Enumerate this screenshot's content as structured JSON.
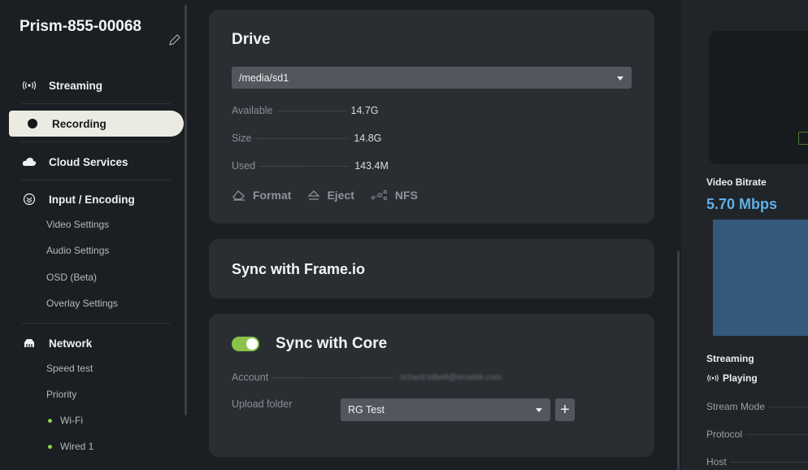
{
  "sidebar": {
    "device_name": "Prism-855-00068",
    "nav": {
      "streaming": "Streaming",
      "recording": "Recording",
      "cloud": "Cloud Services",
      "input": "Input / Encoding",
      "network": "Network"
    },
    "input_sub": [
      "Video Settings",
      "Audio Settings",
      "OSD (Beta)",
      "Overlay Settings"
    ],
    "network_sub": [
      "Speed test",
      "Priority"
    ],
    "network_links": [
      "Wi-Fi",
      "Wired 1"
    ]
  },
  "drive": {
    "title": "Drive",
    "selected_path": "/media/sd1",
    "available_label": "Available",
    "available_value": "14.7G",
    "size_label": "Size",
    "size_value": "14.8G",
    "used_label": "Used",
    "used_value": "143.4M",
    "format_label": "Format",
    "eject_label": "Eject",
    "nfs_label": "NFS"
  },
  "frameio": {
    "title": "Sync with Frame.io"
  },
  "core": {
    "title": "Sync with Core",
    "enabled": true,
    "account_label": "Account",
    "account_value": "richard.bilbelt@teradek.com",
    "upload_label": "Upload folder",
    "upload_value": "RG Test",
    "add_label": "+"
  },
  "right": {
    "bitrate_label": "Video Bitrate",
    "bitrate_value": "5.70 Mbps",
    "streaming_label": "Streaming",
    "status": "Playing",
    "stream_mode_label": "Stream Mode",
    "protocol_label": "Protocol",
    "host_label": "Host"
  },
  "colors": {
    "accent_green": "#8bc24a",
    "bitrate_blue": "#5eb0ea",
    "active_nav_bg": "#ecebe2"
  }
}
